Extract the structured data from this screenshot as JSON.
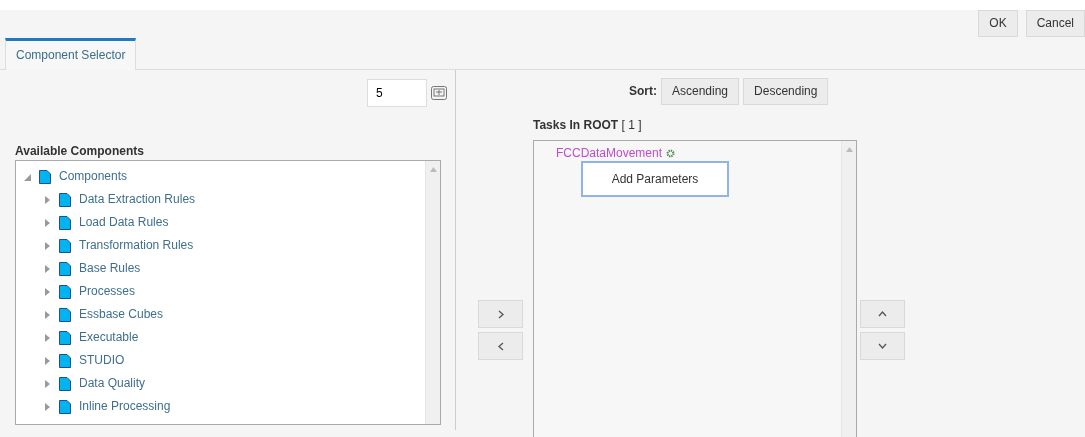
{
  "dialog_buttons": [
    "OK",
    "Cancel"
  ],
  "tabs": [
    {
      "label": "Component Selector",
      "selected": true
    }
  ],
  "page_size": {
    "value": "5"
  },
  "available_components": {
    "title": "Available Components",
    "tree": [
      {
        "label": "Components",
        "expanded": true,
        "children": [
          {
            "label": "Data Extraction Rules",
            "expanded": false
          },
          {
            "label": "Load Data Rules",
            "expanded": false
          },
          {
            "label": "Transformation Rules",
            "expanded": false
          },
          {
            "label": "Base Rules",
            "expanded": false
          },
          {
            "label": "Processes",
            "expanded": false
          },
          {
            "label": "Essbase Cubes",
            "expanded": false
          },
          {
            "label": "Executable",
            "expanded": false
          },
          {
            "label": "STUDIO",
            "expanded": false
          },
          {
            "label": "Data Quality",
            "expanded": false
          },
          {
            "label": "Inline Processing",
            "expanded": false
          }
        ]
      }
    ]
  },
  "sort": {
    "label": "Sort:",
    "buttons": [
      "Ascending",
      "Descending"
    ]
  },
  "tasks": {
    "title": "Tasks In ROOT",
    "count": "[ 1 ]",
    "items": [
      {
        "label": "FCCDataMovement"
      }
    ]
  },
  "context_menu": {
    "items": [
      "Add Parameters"
    ]
  }
}
